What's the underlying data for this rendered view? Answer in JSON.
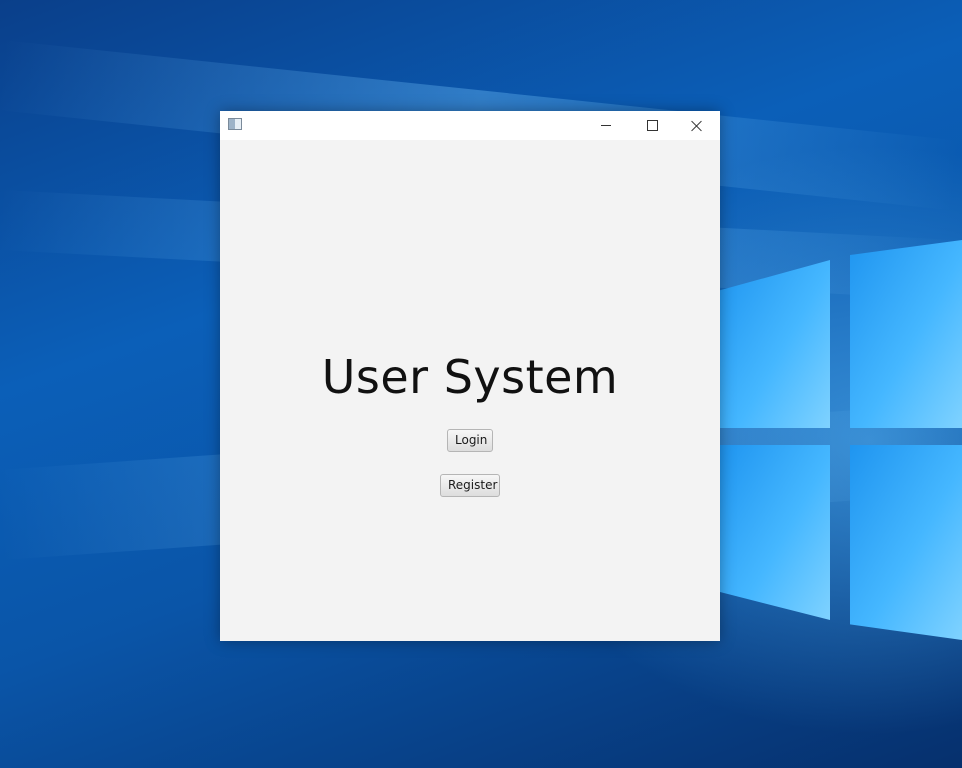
{
  "window": {
    "title": "",
    "icon": "app-window-icon",
    "controls": {
      "minimize": "minimize-icon",
      "maximize": "maximize-icon",
      "close": "close-icon"
    }
  },
  "main": {
    "heading": "User System",
    "login_label": "Login",
    "register_label": "Register"
  },
  "desktop": {
    "wallpaper": "windows-10-hero-wallpaper",
    "accent": "#0b5fb8",
    "logo_color": "#45b7ff"
  }
}
